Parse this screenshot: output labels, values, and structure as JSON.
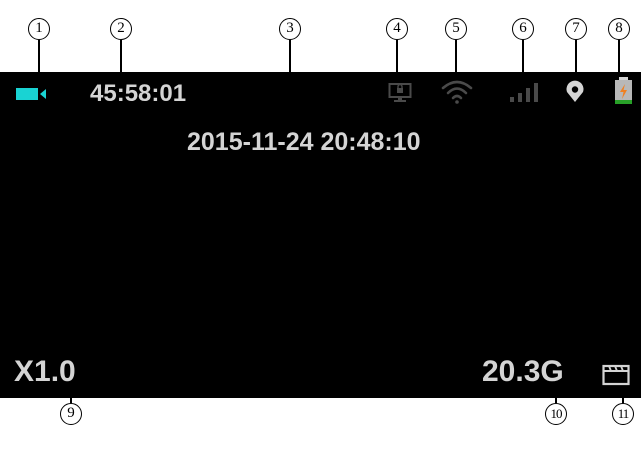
{
  "callouts": [
    "1",
    "2",
    "3",
    "4",
    "5",
    "6",
    "7",
    "8",
    "9",
    "10",
    "11"
  ],
  "status_bar": {
    "recording_icon": "video-camera-icon",
    "recording_time": "45:58:01",
    "icons": [
      "screen-lock-icon",
      "wifi-icon",
      "signal-strength-icon",
      "gps-location-icon",
      "battery-charging-icon"
    ]
  },
  "datetime": "2015-11-24 20:48:10",
  "bottom_bar": {
    "zoom": "X1.0",
    "storage": "20.3G",
    "storage_icon": "sd-card-icon"
  },
  "colors": {
    "screen_bg": "#000000",
    "text": "#d4d4d4",
    "recording_icon": "#19d3d3",
    "dim_icon": "#4a4a4a",
    "battery_bolt": "#f08020",
    "battery_fill": "#28a028"
  }
}
